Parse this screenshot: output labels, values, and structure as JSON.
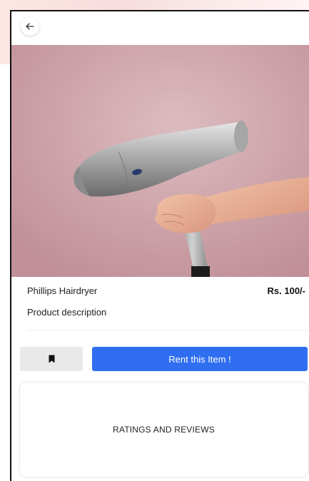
{
  "header": {
    "back_icon": "arrow-left-icon"
  },
  "product": {
    "image": "hairdryer-photo",
    "name": "Phillips Hairdryer",
    "price": "Rs. 100/-",
    "description": "Product description"
  },
  "actions": {
    "bookmark_icon": "bookmark-icon",
    "rent_label": "Rent this Item !"
  },
  "reviews": {
    "title": "RATINGS AND REVIEWS"
  },
  "colors": {
    "primary": "#2f6ef0",
    "secondary_button": "#e9e9e9",
    "hero_background": "#d2a7ad"
  }
}
